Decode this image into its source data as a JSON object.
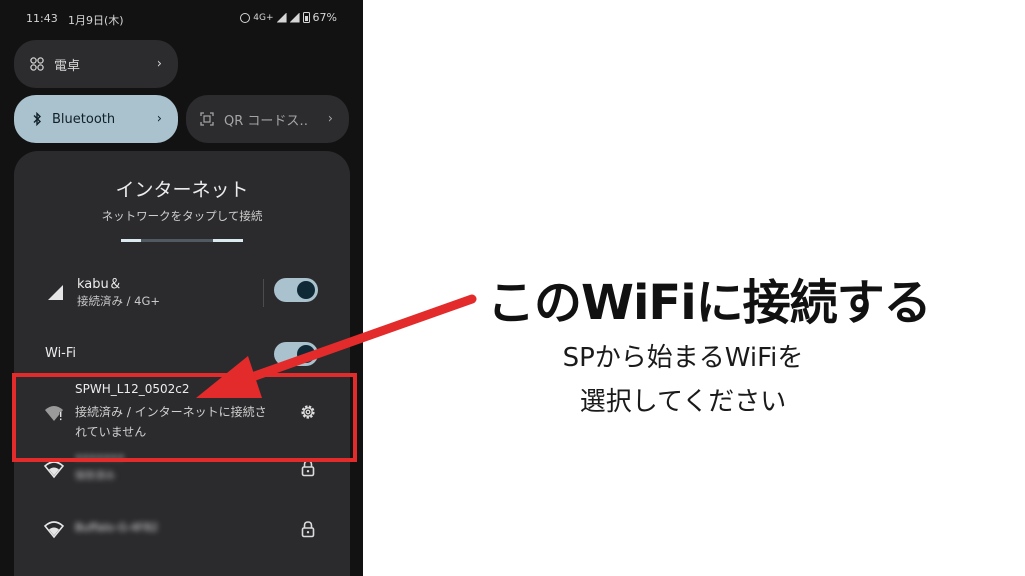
{
  "status_bar": {
    "time": "11:43",
    "date": "1月9日(木)",
    "network": "4G+",
    "battery": "67%"
  },
  "tiles": {
    "calculator": {
      "label": "電卓",
      "icon": "calculator-icon"
    },
    "bluetooth": {
      "label": "Bluetooth",
      "icon": "bluetooth-icon"
    },
    "qr": {
      "label": "QR コードス‥",
      "icon": "qr-scan-icon"
    }
  },
  "internet_panel": {
    "title": "インターネット",
    "subtitle": "ネットワークをタップして接続",
    "mobile": {
      "name": "kabu＆",
      "status": "接続済み / 4G+",
      "toggle_on": true
    },
    "wifi_label": "Wi-Fi",
    "wifi_toggle_on": true,
    "networks": [
      {
        "name": "SPWH_L12_0502c2",
        "status": "接続済み / インターネットに接続されていません",
        "icon": "wifi-warning-icon",
        "action_icon": "gear-icon"
      },
      {
        "name": "•••••••",
        "status": "保存済み",
        "icon": "wifi-icon",
        "action_icon": "lock-icon"
      },
      {
        "name": "Buffalo-G-4F82",
        "status": "",
        "icon": "wifi-icon",
        "action_icon": "lock-icon"
      }
    ]
  },
  "annotation": {
    "heading": "このWiFiに接続する",
    "line1": "SPから始まるWiFiを",
    "line2": "選択してください",
    "accent_color": "#e32b2b"
  }
}
